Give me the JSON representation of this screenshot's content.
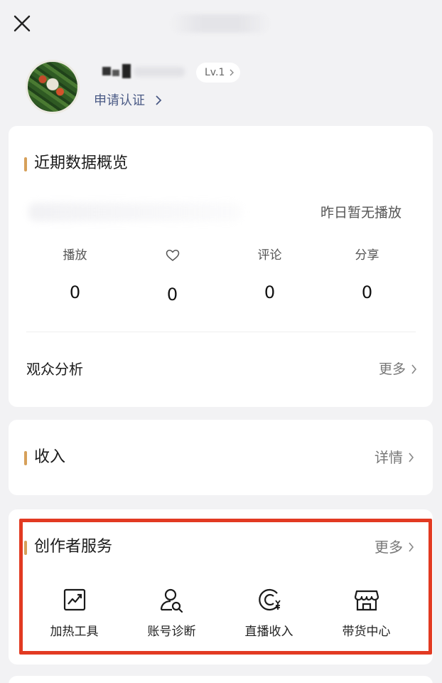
{
  "header": {
    "close_icon": "close-icon"
  },
  "profile": {
    "level_label": "Lv.1",
    "apply_label": "申请认证"
  },
  "overview": {
    "title": "近期数据概览",
    "note": "昨日暂无播放",
    "stats": [
      {
        "label": "播放",
        "value": "0"
      },
      {
        "label": "",
        "icon": "heart-icon",
        "value": "0"
      },
      {
        "label": "评论",
        "value": "0"
      },
      {
        "label": "分享",
        "value": "0"
      }
    ],
    "audience_label": "观众分析",
    "audience_more": "更多"
  },
  "income": {
    "title": "收入",
    "detail_label": "详情"
  },
  "services": {
    "title": "创作者服务",
    "more_label": "更多",
    "tools": [
      {
        "label": "加热工具",
        "icon": "trend-chart-icon"
      },
      {
        "label": "账号诊断",
        "icon": "user-search-icon"
      },
      {
        "label": "直播收入",
        "icon": "live-income-icon"
      },
      {
        "label": "带货中心",
        "icon": "store-icon"
      }
    ]
  },
  "colors": {
    "accent_bar": "#d6a05a",
    "highlight_frame": "#e23a22",
    "link_blue": "#4a5a85"
  }
}
